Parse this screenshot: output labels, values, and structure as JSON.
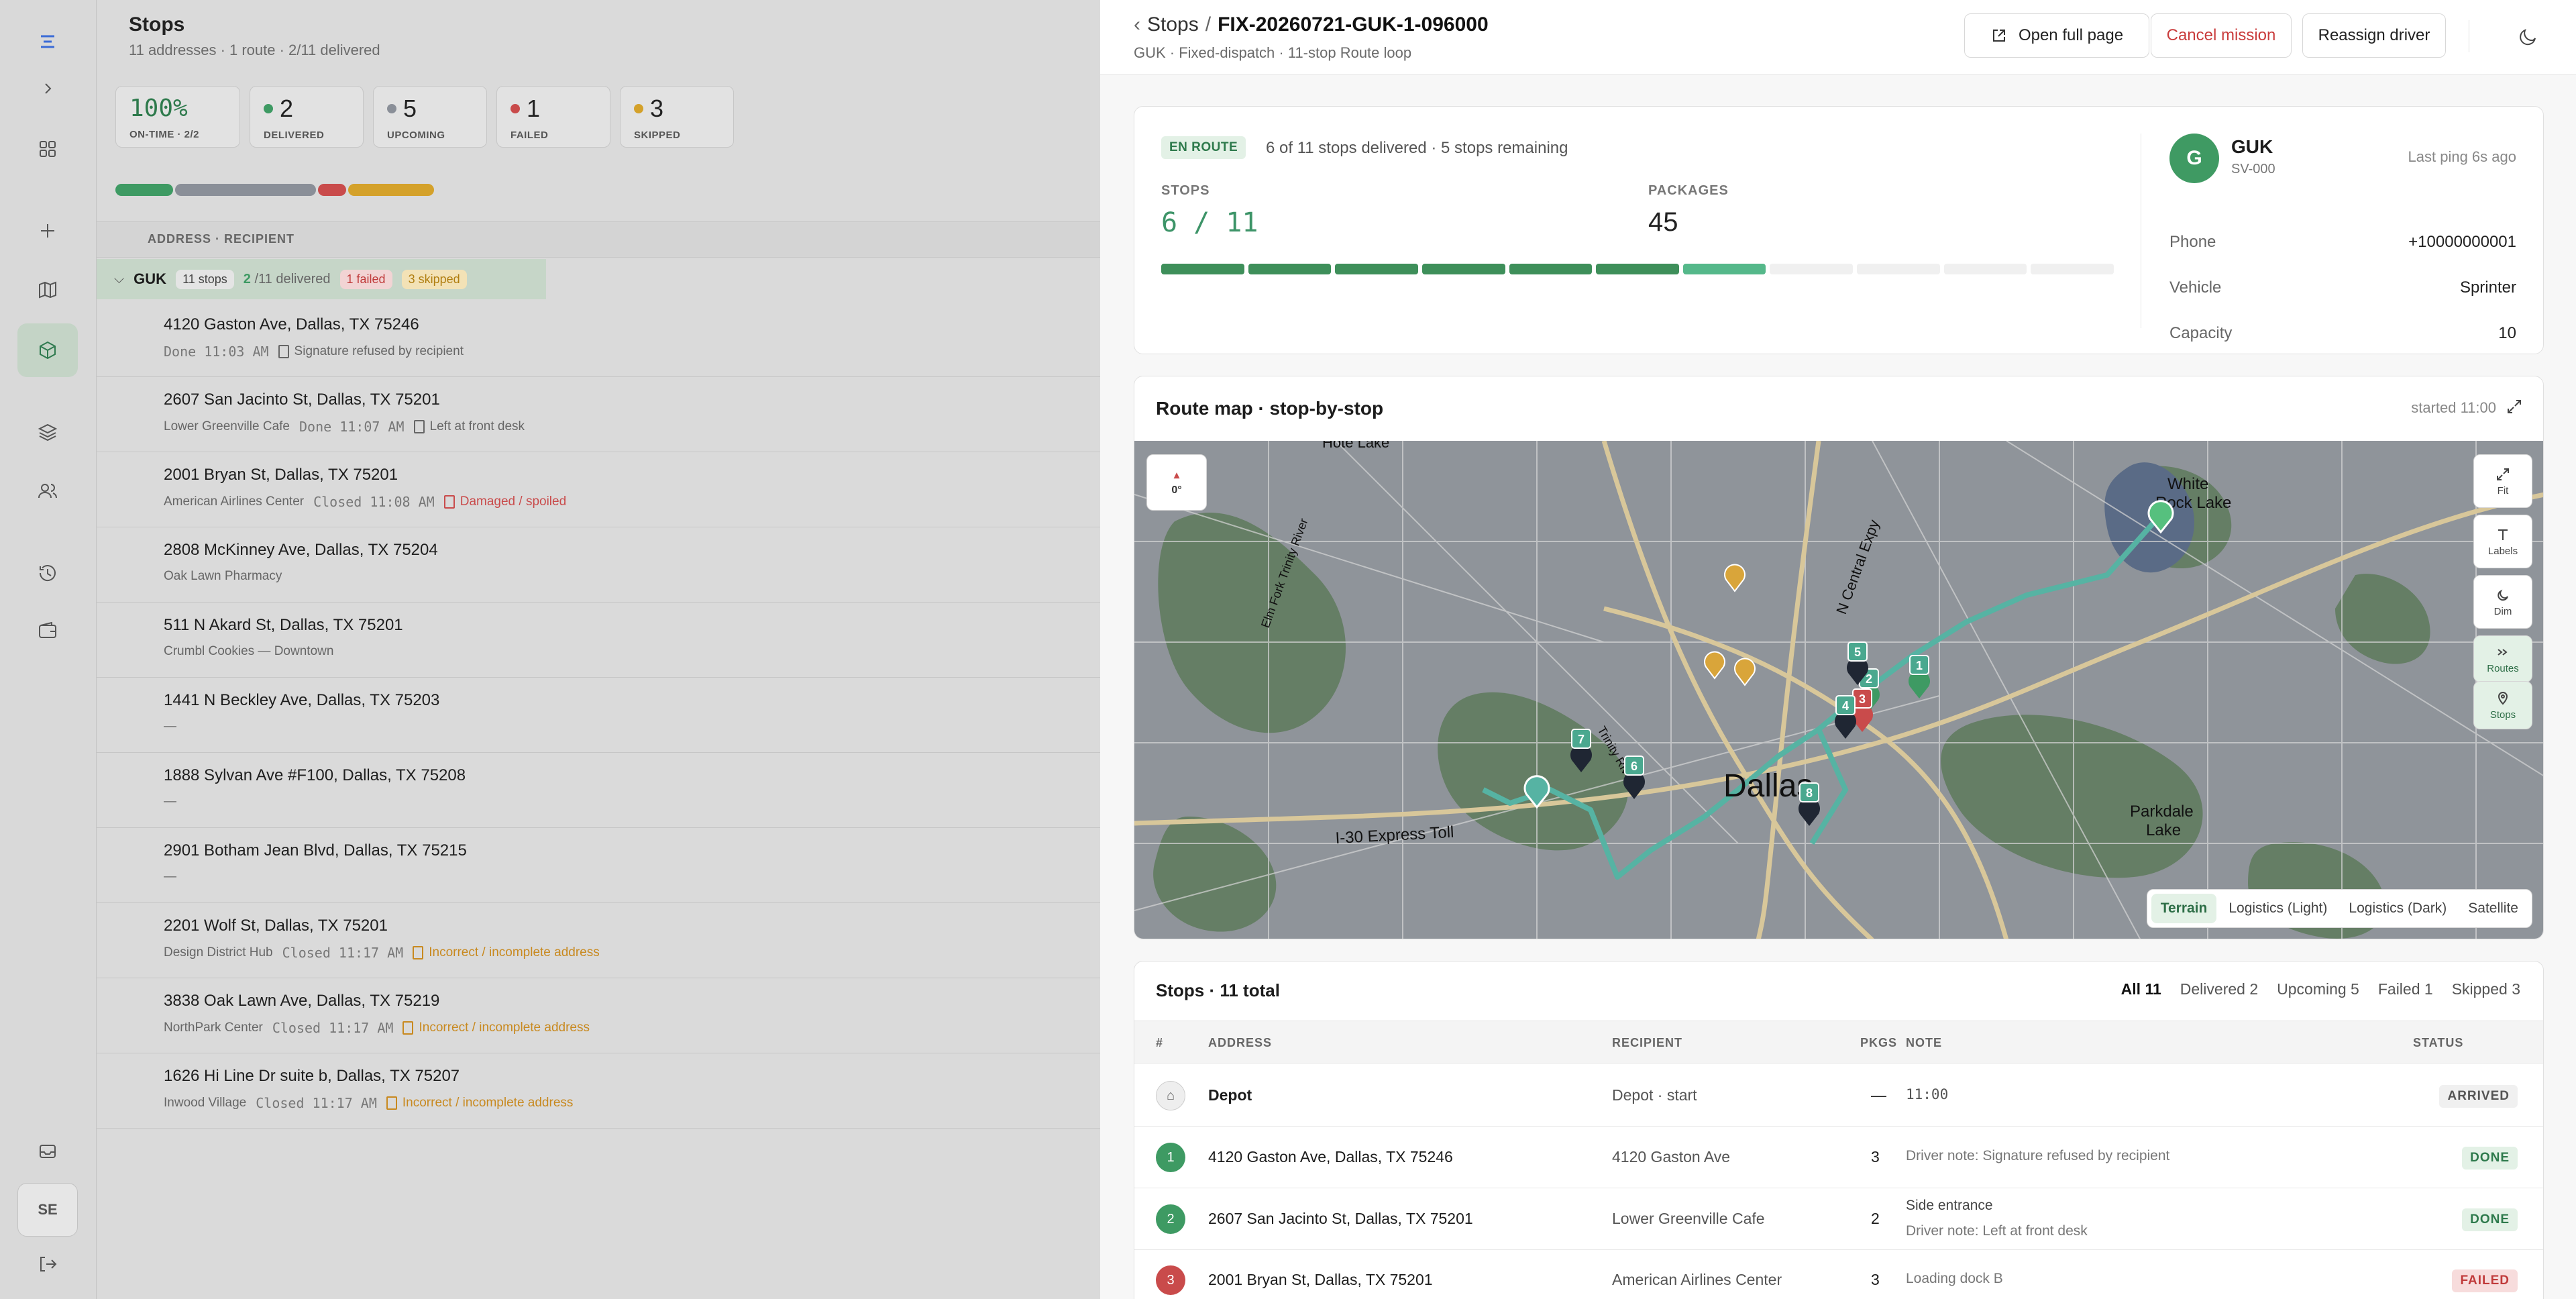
{
  "rail": {
    "user_initials": "SE"
  },
  "stops_panel": {
    "title": "Stops",
    "subtitle": "11 addresses · 1 route · 2/11 delivered",
    "stats": [
      {
        "value": "100%",
        "label": "ON-TIME · 2/2",
        "color": ""
      },
      {
        "value": "2",
        "label": "DELIVERED",
        "color": "#3e9a63"
      },
      {
        "value": "5",
        "label": "UPCOMING",
        "color": "#8a8f98"
      },
      {
        "value": "1",
        "label": "FAILED",
        "color": "#c94b4b"
      },
      {
        "value": "3",
        "label": "SKIPPED",
        "color": "#d4a12a"
      }
    ],
    "column_header": "ADDRESS · RECIPIENT",
    "group": {
      "name": "GUK",
      "stops": "11 stops",
      "delivered_count": "2",
      "delivered_rest": "/11 delivered",
      "failed": "1 failed",
      "skipped": "3 skipped"
    },
    "rows": [
      {
        "address": "4120 Gaston Ave, Dallas, TX 75246",
        "recipient": "",
        "time": "Done 11:03 AM",
        "note": "Signature refused by recipient",
        "note_color": "#666"
      },
      {
        "address": "2607 San Jacinto St, Dallas, TX 75201",
        "recipient": "Lower Greenville Cafe",
        "time": "Done 11:07 AM",
        "note": "Left at front desk",
        "note_color": "#666"
      },
      {
        "address": "2001 Bryan St, Dallas, TX 75201",
        "recipient": "American Airlines Center",
        "time": "Closed 11:08 AM",
        "note": "Damaged / spoiled",
        "note_color": "#c94b4b"
      },
      {
        "address": "2808 McKinney Ave, Dallas, TX 75204",
        "recipient": "Oak Lawn Pharmacy",
        "time": "",
        "note": "",
        "note_color": ""
      },
      {
        "address": "511 N Akard St, Dallas, TX 75201",
        "recipient": "Crumbl Cookies — Downtown",
        "time": "",
        "note": "",
        "note_color": ""
      },
      {
        "address": "1441 N Beckley Ave, Dallas, TX 75203",
        "recipient": "—",
        "time": "",
        "note": "",
        "note_color": ""
      },
      {
        "address": "1888 Sylvan Ave #F100, Dallas, TX 75208",
        "recipient": "—",
        "time": "",
        "note": "",
        "note_color": ""
      },
      {
        "address": "2901 Botham Jean Blvd, Dallas, TX 75215",
        "recipient": "—",
        "time": "",
        "note": "",
        "note_color": ""
      },
      {
        "address": "2201 Wolf St, Dallas, TX 75201",
        "recipient": "Design District Hub",
        "time": "Closed 11:17 AM",
        "note": "Incorrect / incomplete address",
        "note_color": "#c8891f"
      },
      {
        "address": "3838 Oak Lawn Ave, Dallas, TX 75219",
        "recipient": "NorthPark Center",
        "time": "Closed 11:17 AM",
        "note": "Incorrect / incomplete address",
        "note_color": "#c8891f"
      },
      {
        "address": "1626 Hi Line Dr suite b, Dallas, TX 75207",
        "recipient": "Inwood Village",
        "time": "Closed 11:17 AM",
        "note": "Incorrect / incomplete address",
        "note_color": "#c8891f"
      }
    ]
  },
  "detail": {
    "breadcrumb_parent": "Stops",
    "breadcrumb_sep": "/",
    "mission_id": "FIX-20260721-GUK-1-096000",
    "subtitle": "GUK · Fixed-dispatch · 11-stop Route loop",
    "buttons": {
      "open_full": "Open full page",
      "cancel": "Cancel mission",
      "reassign": "Reassign driver"
    },
    "status": {
      "badge": "EN ROUTE",
      "summary": "6 of 11 stops delivered · 5 stops remaining",
      "stops_label": "STOPS",
      "stops_value": "6 / 11",
      "packages_label": "PACKAGES",
      "packages_value": "45",
      "segments_done": 6,
      "segments_active": 1,
      "segments_total": 11
    },
    "driver": {
      "initial": "G",
      "name": "GUK",
      "id": "SV-000",
      "ping": "Last ping 6s ago",
      "fields": [
        {
          "k": "Phone",
          "v": "+10000000001"
        },
        {
          "k": "Vehicle",
          "v": "Sprinter"
        },
        {
          "k": "Capacity",
          "v": "10"
        }
      ]
    },
    "map": {
      "title": "Route map · stop-by-stop",
      "started": "started 11:00",
      "compass": "0°",
      "controls": [
        "Fit",
        "Labels",
        "Dim",
        "Routes",
        "Stops"
      ],
      "city_label": "Dallas",
      "places": [
        "White Rock Lake",
        "Parkdale Lake",
        "I-30 Express Toll",
        "N Central Expy",
        "Trinity River",
        "Elm Fork Trinity River",
        "Hote Lake"
      ],
      "styles": [
        "Terrain",
        "Logistics (Light)",
        "Logistics (Dark)",
        "Satellite"
      ],
      "active_style": "Terrain",
      "markers": [
        "1",
        "2",
        "3",
        "4",
        "5",
        "6",
        "7",
        "8"
      ]
    },
    "list": {
      "title": "Stops · 11 total",
      "filters": [
        "All 11",
        "Delivered 2",
        "Upcoming 5",
        "Failed 1",
        "Skipped 3"
      ],
      "headers": {
        "num": "#",
        "address": "ADDRESS",
        "recipient": "RECIPIENT",
        "pkgs": "PKGS",
        "note": "NOTE",
        "status": "STATUS"
      },
      "rows": [
        {
          "num": "",
          "address": "Depot",
          "recipient": "Depot · start",
          "pkgs": "—",
          "note": "11:00",
          "note2": "",
          "status": "ARRIVED"
        },
        {
          "num": "1",
          "address": "4120 Gaston Ave, Dallas, TX 75246",
          "recipient": "4120 Gaston Ave",
          "pkgs": "3",
          "note": "Driver note: Signature refused by recipient",
          "note2": "",
          "status": "DONE"
        },
        {
          "num": "2",
          "address": "2607 San Jacinto St, Dallas, TX 75201",
          "recipient": "Lower Greenville Cafe",
          "pkgs": "2",
          "note": "Side entrance",
          "note2": "Driver note: Left at front desk",
          "status": "DONE"
        },
        {
          "num": "3",
          "address": "2001 Bryan St, Dallas, TX 75201",
          "recipient": "American Airlines Center",
          "pkgs": "3",
          "note": "Loading dock B",
          "note2": "",
          "status": "FAILED"
        }
      ]
    }
  }
}
